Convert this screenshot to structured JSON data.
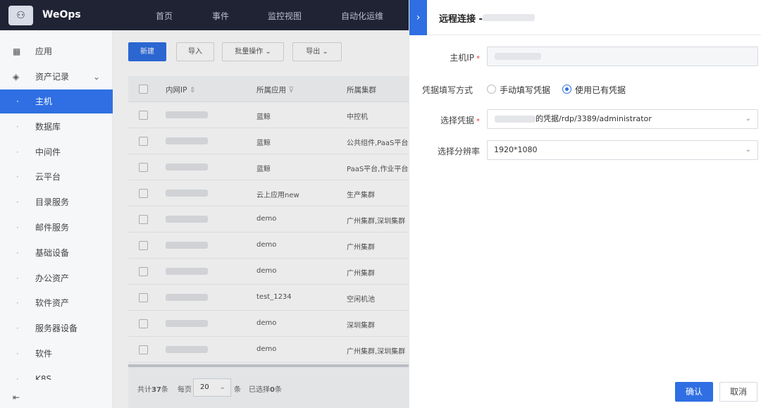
{
  "app": {
    "brand": "WeOps"
  },
  "nav": [
    "首页",
    "事件",
    "监控视图",
    "自动化运维"
  ],
  "sidebar": {
    "top_item": "应用",
    "group": "资产记录",
    "items": [
      "主机",
      "数据库",
      "中间件",
      "云平台",
      "目录服务",
      "邮件服务",
      "基础设备",
      "办公资产",
      "软件资产",
      "服务器设备",
      "软件",
      "K8S"
    ]
  },
  "toolbar": {
    "new": "新建",
    "import": "导入",
    "batch": "批量操作",
    "export": "导出"
  },
  "table": {
    "headers": [
      "内网IP",
      "所属应用",
      "所属集群"
    ],
    "rows": [
      {
        "app": "蓝鲸",
        "cluster": "中控机"
      },
      {
        "app": "蓝鲸",
        "cluster": "公共组件,PaaS平台"
      },
      {
        "app": "蓝鲸",
        "cluster": "PaaS平台,作业平台"
      },
      {
        "app": "云上应用new",
        "cluster": "生产集群"
      },
      {
        "app": "demo",
        "cluster": "广州集群,深圳集群"
      },
      {
        "app": "demo",
        "cluster": "广州集群"
      },
      {
        "app": "demo",
        "cluster": "广州集群"
      },
      {
        "app": "test_1234",
        "cluster": "空闲机池"
      },
      {
        "app": "demo",
        "cluster": "深圳集群"
      },
      {
        "app": "demo",
        "cluster": "广州集群,深圳集群"
      }
    ]
  },
  "pager": {
    "total_prefix": "共计",
    "total": "37",
    "total_suffix": "条",
    "per_page_label": "每页",
    "per_page": "20",
    "per_unit": "条",
    "selected_prefix": "已选择",
    "selected": "0",
    "selected_suffix": "条"
  },
  "panel": {
    "title": "远程连接 -",
    "host_ip_label": "主机IP",
    "mode_label": "凭据填写方式",
    "mode_manual": "手动填写凭据",
    "mode_existing": "使用已有凭据",
    "cred_label": "选择凭据",
    "cred_value": "的凭据/rdp/3389/administrator",
    "res_label": "选择分辨率",
    "res_value": "1920*1080",
    "confirm": "确认",
    "cancel": "取消"
  }
}
